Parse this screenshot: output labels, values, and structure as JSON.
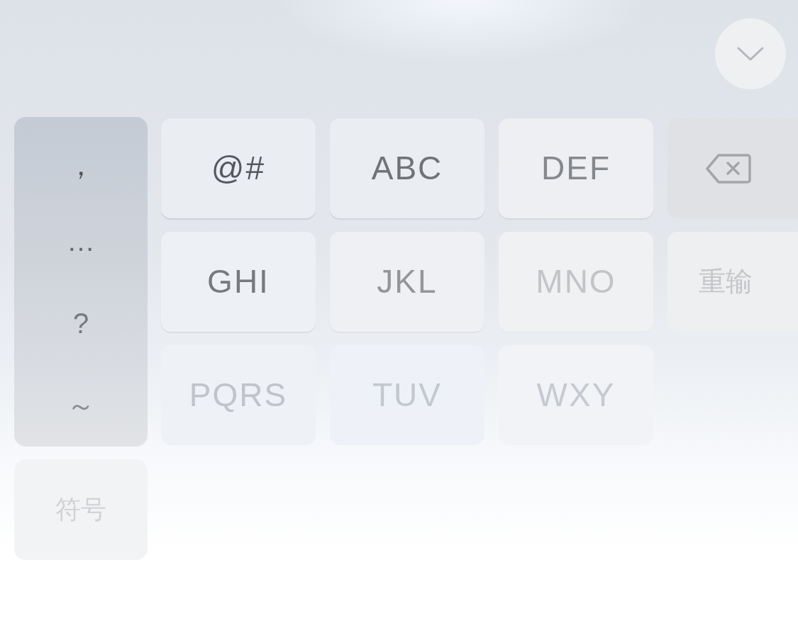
{
  "punctuation_column": [
    "，",
    "…",
    "?",
    "～"
  ],
  "keys": [
    {
      "kind": "letters",
      "label": "@#"
    },
    {
      "kind": "letters",
      "label": "ABC"
    },
    {
      "kind": "letters",
      "label": "DEF"
    },
    {
      "kind": "backspace"
    },
    {
      "kind": "letters",
      "label": "GHI"
    },
    {
      "kind": "letters",
      "label": "JKL"
    },
    {
      "kind": "letters",
      "label": "MNO"
    },
    {
      "kind": "action",
      "label": "重输"
    },
    {
      "kind": "letters",
      "label": "PQRS"
    },
    {
      "kind": "letters",
      "label": "TUV"
    },
    {
      "kind": "letters",
      "label": "WXY"
    }
  ],
  "bottom_row": [
    {
      "label": "符号"
    }
  ]
}
